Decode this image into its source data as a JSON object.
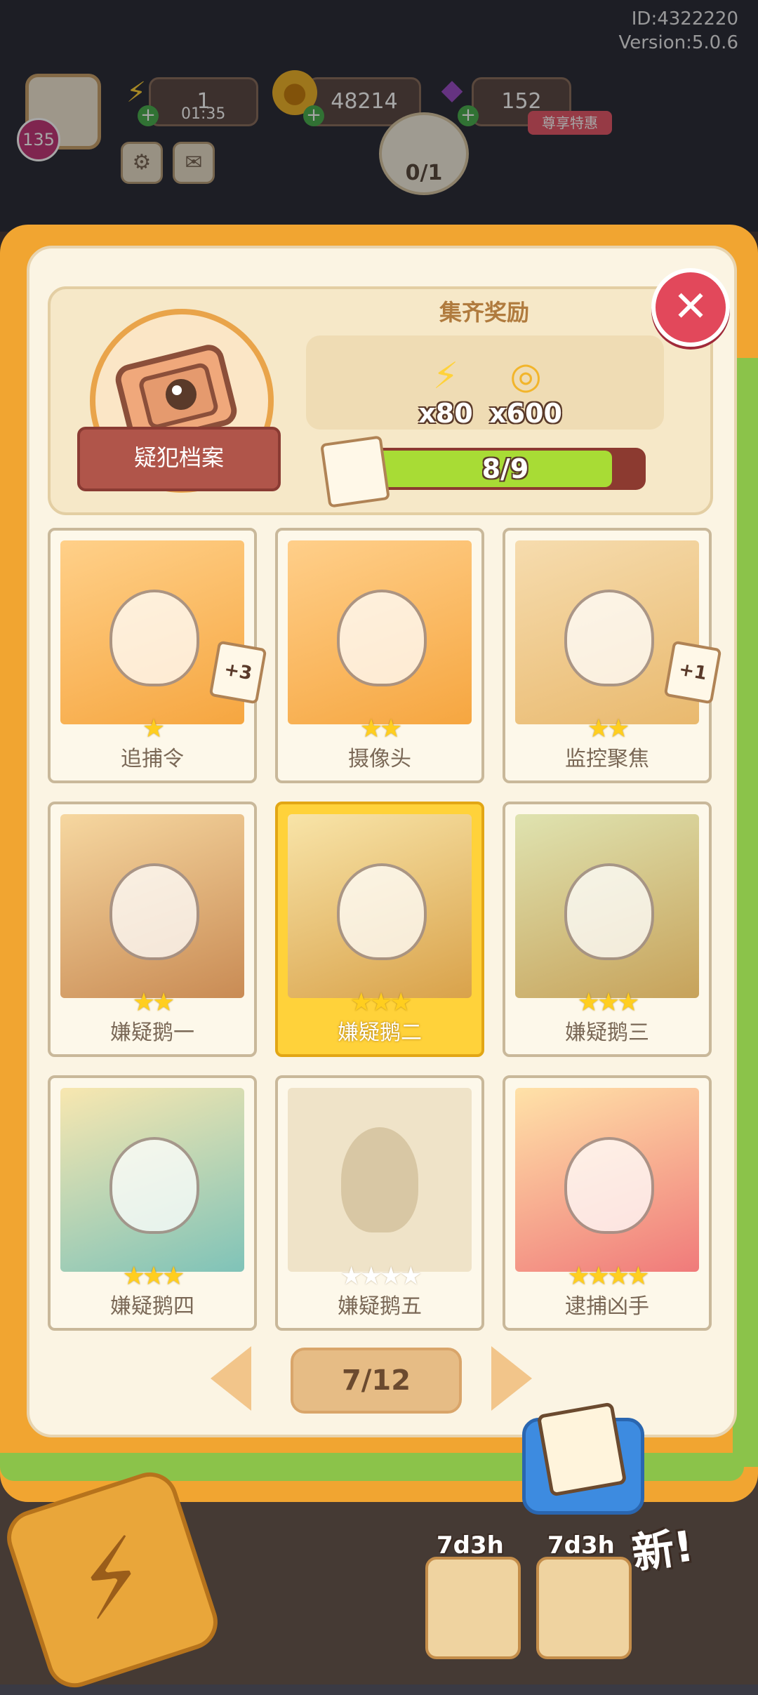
{
  "hud": {
    "id_text": "ID:4322220",
    "version_text": "Version:5.0.6",
    "level": "135",
    "energy": "1",
    "energy_timer": "01:35",
    "coins": "48214",
    "gems": "152",
    "vip_tag": "尊享特惠",
    "camera_counter": "0/1"
  },
  "header": {
    "album_name": "疑犯档案",
    "reward_title": "集齐奖励",
    "rewards": [
      {
        "icon": "energy-bolt-icon",
        "amount": "x80"
      },
      {
        "icon": "coin-stack-icon",
        "amount": "x600"
      }
    ],
    "progress_text": "8/9",
    "progress_value": 0.889
  },
  "cards": [
    {
      "label": "追捕令",
      "stars": 1,
      "collected": true,
      "badge": "+3",
      "highlight": false,
      "art": "wanted-poster"
    },
    {
      "label": "摄像头",
      "stars": 2,
      "collected": true,
      "badge": "",
      "highlight": false,
      "art": "security-camera"
    },
    {
      "label": "监控聚焦",
      "stars": 2,
      "collected": true,
      "badge": "+1",
      "highlight": false,
      "art": "snail-on-table"
    },
    {
      "label": "嫌疑鹅一",
      "stars": 2,
      "collected": true,
      "badge": "",
      "highlight": false,
      "art": "sleeping-goose"
    },
    {
      "label": "嫌疑鹅二",
      "stars": 3,
      "collected": true,
      "badge": "",
      "highlight": true,
      "art": "boxing-geese"
    },
    {
      "label": "嫌疑鹅三",
      "stars": 3,
      "collected": true,
      "badge": "",
      "highlight": false,
      "art": "hooded-goose"
    },
    {
      "label": "嫌疑鹅四",
      "stars": 3,
      "collected": true,
      "badge": "",
      "highlight": false,
      "art": "headphone-goose"
    },
    {
      "label": "嫌疑鹅五",
      "stars": 4,
      "collected": false,
      "badge": "",
      "highlight": false,
      "art": "silhouette"
    },
    {
      "label": "逮捕凶手",
      "stars": 4,
      "collected": true,
      "badge": "",
      "highlight": false,
      "art": "police-geese"
    }
  ],
  "pager": {
    "page_text": "7/12"
  },
  "bottom": {
    "timer_left": "7d3h",
    "timer_right": "7d3h",
    "new_tag": "新!"
  },
  "colors": {
    "panel": "#fbf4e3",
    "book": "#f1a531",
    "accent_green": "#a8dc35",
    "close_red": "#e2485b",
    "star_gold": "#ffce1f"
  }
}
